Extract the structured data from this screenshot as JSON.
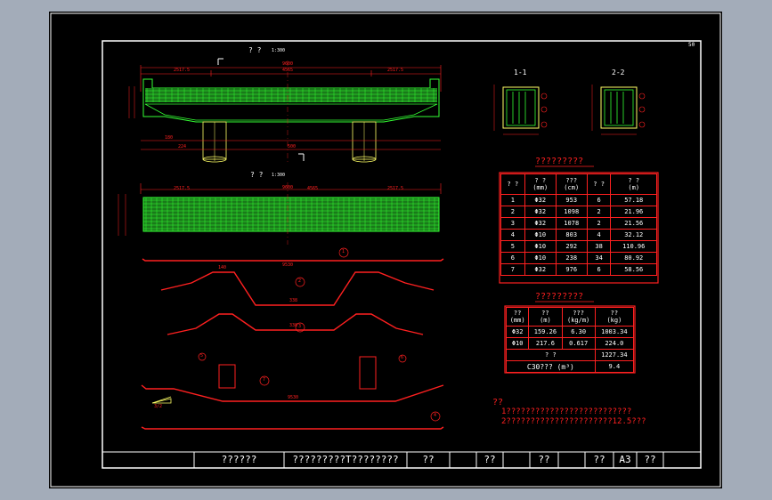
{
  "sheet": {
    "number": "50",
    "elevation_title": "? ?",
    "elevation_scale": "1:300",
    "plan_title": "? ?",
    "plan_scale": "1:300",
    "section_1": "1-1",
    "section_2": "2-2",
    "dims": {
      "top_total": "9600",
      "left_seg": "2517.5",
      "mid_seg": "4565",
      "right_seg": "2517.5",
      "bottom_1": "180",
      "bottom_2": "224",
      "bottom_3": "500",
      "plan_total": "9600",
      "plan_left": "2517.5",
      "plan_mid": "4565",
      "plan_right": "2517.5"
    },
    "bar_labels": {
      "b1": "1",
      "b2": "2",
      "b3": "3",
      "b4": "4",
      "b5": "5",
      "b6": "6",
      "b7": "7"
    },
    "bar_dims": {
      "b1_len": "9530",
      "b2_top": "140",
      "b2_mid": "338",
      "b3_mid": "338",
      "b7_len": "9530",
      "b7_slope": "3/2"
    }
  },
  "table1": {
    "title": "?????????",
    "headers": [
      "? ?",
      "? ?\n(mm)",
      "???\n(cm)",
      "? ?",
      "? ?\n(m)"
    ],
    "rows": [
      [
        "1",
        "Φ32",
        "953",
        "6",
        "57.18"
      ],
      [
        "2",
        "Φ32",
        "1098",
        "2",
        "21.96"
      ],
      [
        "3",
        "Φ32",
        "1078",
        "2",
        "21.56"
      ],
      [
        "4",
        "Φ10",
        "803",
        "4",
        "32.12"
      ],
      [
        "5",
        "Φ10",
        "292",
        "38",
        "110.96"
      ],
      [
        "6",
        "Φ10",
        "238",
        "34",
        "80.92"
      ],
      [
        "7",
        "Φ32",
        "976",
        "6",
        "58.56"
      ]
    ]
  },
  "table2": {
    "title": "?????????",
    "headers": [
      "??\n(mm)",
      "??\n(m)",
      "???\n(kg/m)",
      "??\n(kg)"
    ],
    "rows": [
      [
        "Φ32",
        "159.26",
        "6.30",
        "1003.34"
      ],
      [
        "Φ10",
        "217.6",
        "0.617",
        "224.0"
      ]
    ],
    "total_label": "? ?",
    "total_value": "1227.34",
    "concrete_label": "C30??? (m³)",
    "concrete_value": "9.4"
  },
  "notes": {
    "title": "??",
    "line1": "1??????????????????????????",
    "line2": "2??????????????????????12.5???"
  },
  "title_block": {
    "c1": "??????",
    "c2": "?????????T????????",
    "c3": "??",
    "c4": "??",
    "c5": "??",
    "c6": "??",
    "c7": "A3",
    "c8": "??"
  },
  "colors": {
    "background": "#a3acb9",
    "sheet": "#000000",
    "line": "#ff2020",
    "rebar": "#33ff33",
    "pier": "#ffff66",
    "text": "#ffffff"
  }
}
